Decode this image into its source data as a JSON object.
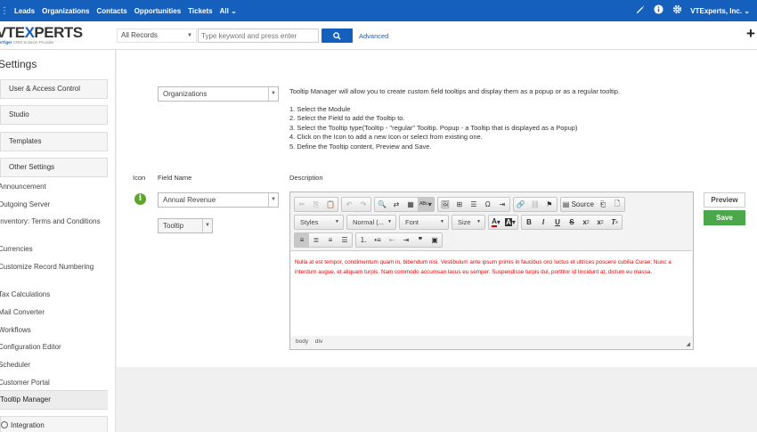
{
  "topnav": {
    "items": [
      "Leads",
      "Organizations",
      "Contacts",
      "Opportunities",
      "Tickets",
      "All"
    ],
    "all_caret": "⌄",
    "company": "VTExperts, Inc.",
    "company_caret": "⌄"
  },
  "header": {
    "logo_vt": "VTE",
    "logo_x": "X",
    "logo_rest": "PERTS",
    "logo_tag_brand": "vTiger",
    "logo_tag_rest": "CRM Solution Provider",
    "records_select": "All Records",
    "search_placeholder": "Type keyword and press enter",
    "advanced_label": "Advanced",
    "plus": "+"
  },
  "sidebar": {
    "title": "Settings",
    "blocks": [
      "User & Access Control",
      "Studio",
      "Templates",
      "Other Settings"
    ],
    "links": [
      "Announcement",
      "Outgoing Server",
      "Inventory: Terms and Conditions",
      "Currencies",
      "Customize Record Numbering",
      "Tax Calculations",
      "Mail Converter",
      "Workflows",
      "Configuration Editor",
      "Scheduler",
      "Customer Portal"
    ],
    "active": "Tooltip Manager",
    "integration": "Integration"
  },
  "main": {
    "module_select": "Organizations",
    "intro": "Tooltip Manager will allow you to create custom field tooltips and display them as a popup or as a regular tooltip.",
    "steps": [
      "1. Select the Module",
      "2. Select the Field to add the Tooltip to.",
      "3. Select the Tooltip type(Tooltip - \"regular\" Tooltip. Popup - a Tooltip that is displayed as a Popup)",
      "4. Click on the Icon to add a new Icon or select from existing one.",
      "5. Define the Tooltip content, Preview and Save."
    ],
    "col_icon": "Icon",
    "col_field": "Field Name",
    "col_desc": "Description",
    "info_glyph": "i",
    "field_select": "Annual Revenue",
    "type_select": "Tooltip",
    "preview_label": "Preview",
    "save_label": "Save"
  },
  "editor": {
    "source_label": "Source",
    "styles_combo": "Styles",
    "format_combo": "Normal (...",
    "font_combo": "Font",
    "size_combo": "Size",
    "content": "Nulla at est tempor, condimentum quam in, bibendum nisi. Vestibulum ante ipsum primis in faucibus orci luctus et ultrices posuere cubilia Curae; Nunc a interdum augue, et aliquam turpis. Nam commodo accumsan lacus eu semper. Suspendisse turpis dui, porttitor id tincidunt at, dictum eu massa.",
    "footer_body": "body",
    "footer_div": "div",
    "content_color": "#e00000"
  },
  "colors": {
    "brand": "#1560bd",
    "save": "#4aa84a",
    "info_icon": "#5aa828"
  }
}
